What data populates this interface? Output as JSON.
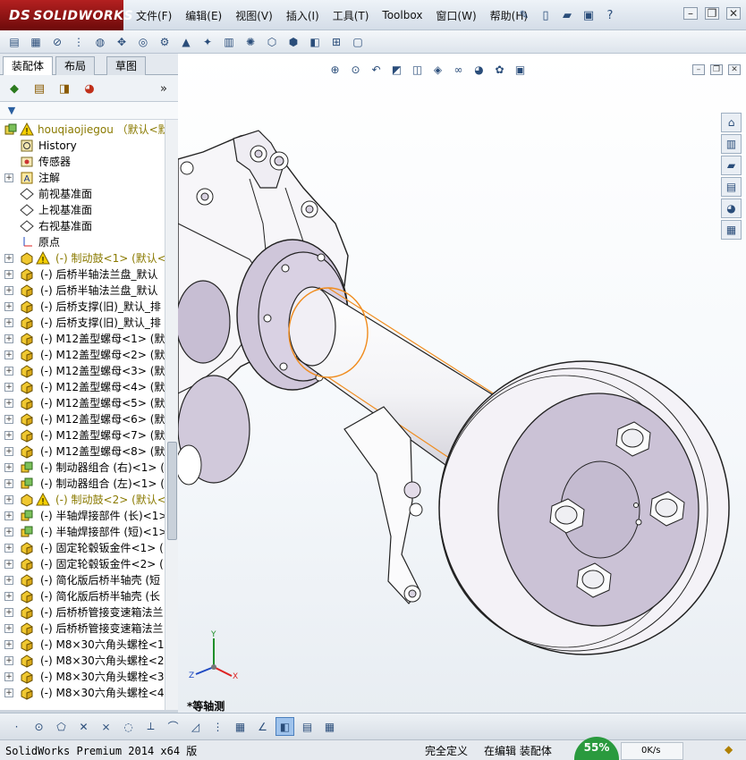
{
  "app": {
    "brand": "SOLIDWORKS",
    "brand_prefix": "DS"
  },
  "menu": [
    "文件(F)",
    "编辑(E)",
    "视图(V)",
    "插入(I)",
    "工具(T)",
    "Toolbox",
    "窗口(W)",
    "帮助(H)"
  ],
  "tabs": [
    "装配体",
    "布局",
    "草图"
  ],
  "tree": {
    "root": "houqiaojiegou （默认<默认",
    "items": [
      {
        "label": "History",
        "icon": "history-icon",
        "expandable": false,
        "warn": false
      },
      {
        "label": "传感器",
        "icon": "sensor-icon",
        "expandable": false,
        "warn": false
      },
      {
        "label": "注解",
        "icon": "annotation-icon",
        "expandable": true,
        "warn": false
      },
      {
        "label": "前视基准面",
        "icon": "plane-icon",
        "expandable": false,
        "warn": false
      },
      {
        "label": "上视基准面",
        "icon": "plane-icon",
        "expandable": false,
        "warn": false
      },
      {
        "label": "右视基准面",
        "icon": "plane-icon",
        "expandable": false,
        "warn": false
      },
      {
        "label": "原点",
        "icon": "origin-icon",
        "expandable": false,
        "warn": false
      },
      {
        "label": "(-) 制动鼓<1> (默认<",
        "icon": "part-warning-icon",
        "expandable": true,
        "warn": true
      },
      {
        "label": "(-) 后桥半轴法兰盘_默认",
        "icon": "part-icon",
        "expandable": true,
        "warn": false
      },
      {
        "label": "(-) 后桥半轴法兰盘_默认",
        "icon": "part-icon",
        "expandable": true,
        "warn": false
      },
      {
        "label": "(-) 后桥支撑(旧)_默认_排",
        "icon": "part-icon",
        "expandable": true,
        "warn": false
      },
      {
        "label": "(-) 后桥支撑(旧)_默认_排",
        "icon": "part-icon",
        "expandable": true,
        "warn": false
      },
      {
        "label": "(-) M12盖型螺母<1> (默认",
        "icon": "part-icon",
        "expandable": true,
        "warn": false
      },
      {
        "label": "(-) M12盖型螺母<2> (默认",
        "icon": "part-icon",
        "expandable": true,
        "warn": false
      },
      {
        "label": "(-) M12盖型螺母<3> (默认",
        "icon": "part-icon",
        "expandable": true,
        "warn": false
      },
      {
        "label": "(-) M12盖型螺母<4> (默认",
        "icon": "part-icon",
        "expandable": true,
        "warn": false
      },
      {
        "label": "(-) M12盖型螺母<5> (默认",
        "icon": "part-icon",
        "expandable": true,
        "warn": false
      },
      {
        "label": "(-) M12盖型螺母<6> (默认",
        "icon": "part-icon",
        "expandable": true,
        "warn": false
      },
      {
        "label": "(-) M12盖型螺母<7> (默认",
        "icon": "part-icon",
        "expandable": true,
        "warn": false
      },
      {
        "label": "(-) M12盖型螺母<8> (默认",
        "icon": "part-icon",
        "expandable": true,
        "warn": false
      },
      {
        "label": "(-) 制动器组合 (右)<1> (",
        "icon": "assembly-icon",
        "expandable": true,
        "warn": false
      },
      {
        "label": "(-) 制动器组合 (左)<1> (",
        "icon": "assembly-icon",
        "expandable": true,
        "warn": false
      },
      {
        "label": "(-) 制动鼓<2> (默认<",
        "icon": "part-warning-icon",
        "expandable": true,
        "warn": true
      },
      {
        "label": "(-) 半轴焊接部件 (长)<1>",
        "icon": "assembly-icon",
        "expandable": true,
        "warn": false
      },
      {
        "label": "(-) 半轴焊接部件 (短)<1>",
        "icon": "assembly-icon",
        "expandable": true,
        "warn": false
      },
      {
        "label": "(-) 固定轮毂钣金件<1> (",
        "icon": "part-icon",
        "expandable": true,
        "warn": false
      },
      {
        "label": "(-) 固定轮毂钣金件<2> (",
        "icon": "part-icon",
        "expandable": true,
        "warn": false
      },
      {
        "label": "(-) 简化版后桥半轴壳 (短",
        "icon": "part-icon",
        "expandable": true,
        "warn": false
      },
      {
        "label": "(-) 简化版后桥半轴壳 (长",
        "icon": "part-icon",
        "expandable": true,
        "warn": false
      },
      {
        "label": "(-) 后桥桥管接变速箱法兰",
        "icon": "part-icon",
        "expandable": true,
        "warn": false
      },
      {
        "label": "(-) 后桥桥管接变速箱法兰",
        "icon": "part-icon",
        "expandable": true,
        "warn": false
      },
      {
        "label": "(-) M8×30六角头螺栓<1>",
        "icon": "part-icon",
        "expandable": true,
        "warn": false
      },
      {
        "label": "(-) M8×30六角头螺栓<2>",
        "icon": "part-icon",
        "expandable": true,
        "warn": false
      },
      {
        "label": "(-) M8×30六角头螺栓<3>",
        "icon": "part-icon",
        "expandable": true,
        "warn": false
      },
      {
        "label": "(-) M8×30六角头螺栓<4>",
        "icon": "part-icon",
        "expandable": true,
        "warn": false
      }
    ]
  },
  "viewport": {
    "view_label": "*等轴测",
    "triad": {
      "x": "X",
      "y": "Y",
      "z": "Z"
    }
  },
  "status": {
    "product": "SolidWorks Premium 2014 x64 版",
    "state": "完全定义",
    "mode": "在编辑 装配体",
    "speed_percent": "55%",
    "net": "0K/s"
  },
  "colors": {
    "selection": "#f08c1e",
    "part_face": "#c9bfd4",
    "brand_red": "#a01818"
  }
}
